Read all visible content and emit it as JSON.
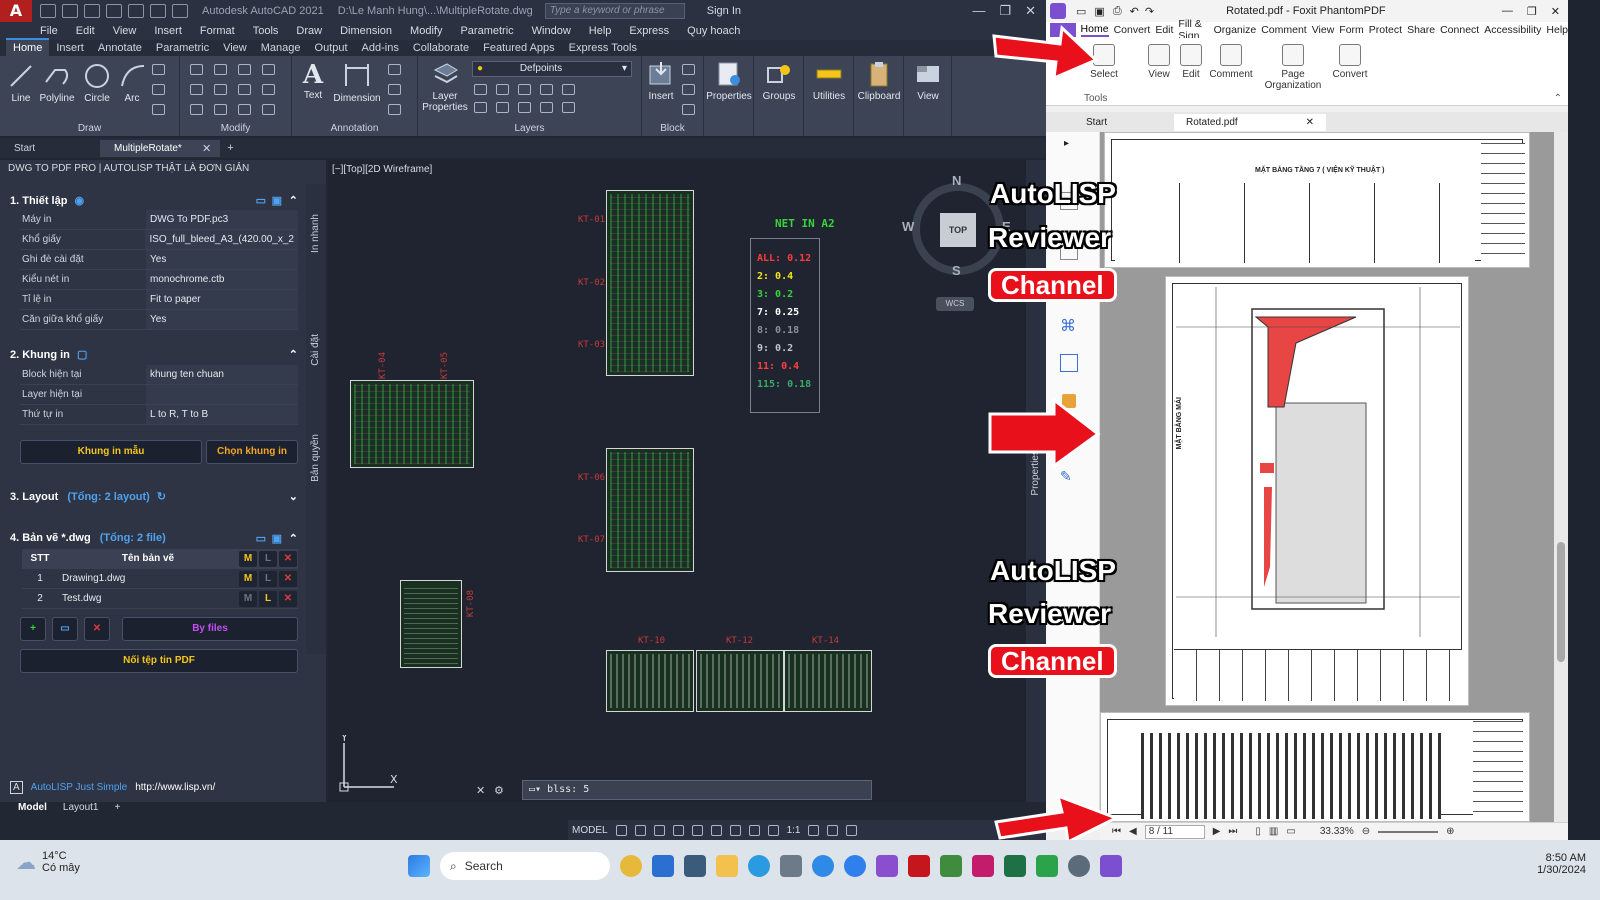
{
  "acad": {
    "title": "Autodesk AutoCAD 2021",
    "path": "D:\\Le Manh Hung\\...\\MultipleRotate.dwg",
    "search_placeholder": "Type a keyword or phrase",
    "signin": "Sign In",
    "menu": [
      "File",
      "Edit",
      "View",
      "Insert",
      "Format",
      "Tools",
      "Draw",
      "Dimension",
      "Modify",
      "Parametric",
      "Window",
      "Help",
      "Express",
      "Quy hoach"
    ],
    "ribbon_tabs": [
      "Home",
      "Insert",
      "Annotate",
      "Parametric",
      "View",
      "Manage",
      "Output",
      "Add-ins",
      "Collaborate",
      "Featured Apps",
      "Express Tools"
    ],
    "tools": {
      "line": "Line",
      "polyline": "Polyline",
      "circle": "Circle",
      "arc": "Arc",
      "text": "Text",
      "dimension": "Dimension",
      "layer_properties": "Layer\nProperties",
      "insert": "Insert",
      "properties": "Properties",
      "groups": "Groups",
      "utilities": "Utilities",
      "clipboard": "Clipboard",
      "view": "View"
    },
    "panels": {
      "draw": "Draw",
      "modify": "Modify",
      "annotation": "Annotation",
      "layers": "Layers",
      "block": "Block"
    },
    "layer_current": "Defpoints",
    "doc_tabs": [
      "Start",
      "MultipleRotate*"
    ],
    "palette": {
      "header": "DWG TO PDF PRO | AUTOLISP THẬT LÀ ĐƠN GIẢN",
      "sec1": "1.  Thiết lập",
      "sec1_rows": [
        {
          "k": "Máy in",
          "v": "DWG To PDF.pc3"
        },
        {
          "k": "Khổ giấy",
          "v": "ISO_full_bleed_A3_(420.00_x_2"
        },
        {
          "k": "Ghi đè cài đặt",
          "v": "Yes"
        },
        {
          "k": "Kiểu nét in",
          "v": "monochrome.ctb"
        },
        {
          "k": "Tỉ lệ in",
          "v": "Fit to paper"
        },
        {
          "k": "Căn giữa khổ giấy",
          "v": "Yes"
        }
      ],
      "sec2": "2.  Khung in",
      "sec2_rows": [
        {
          "k": "Block hiện tại",
          "v": "khung ten chuan"
        },
        {
          "k": "Layer hiện tại",
          "v": ""
        },
        {
          "k": "Thứ tự in",
          "v": "L to R, T to B"
        }
      ],
      "btn_sample": "Khung in mẫu",
      "btn_pick": "Chọn khung in",
      "sec3": "3.  Layout",
      "sec3_count": "(Tổng: 2 layout)",
      "sec4": "4.  Bản vẽ *.dwg",
      "sec4_count": "(Tổng: 2 file)",
      "tbl_stt": "STT",
      "tbl_name": "Tên bản vẽ",
      "files": [
        {
          "stt": "1",
          "name": "Drawing1.dwg"
        },
        {
          "stt": "2",
          "name": "Test.dwg"
        }
      ],
      "btn_byfiles": "By files",
      "btn_merge": "Nối tệp tin PDF",
      "foot_brand": "AutoLISP Just Simple",
      "foot_url": "http://www.lisp.vn/",
      "side_labels": [
        "In nhanh",
        "Cài đặt",
        "Bản quyền"
      ]
    },
    "view_label": "[−][Top][2D Wireframe]",
    "net_title": "NET IN A2",
    "net_items": [
      {
        "t": "ALL: 0.12",
        "c": "#ff3b3b"
      },
      {
        "t": "2: 0.4",
        "c": "#f5e614"
      },
      {
        "t": "3: 0.2",
        "c": "#39d439"
      },
      {
        "t": "7: 0.25",
        "c": "#ffffff"
      },
      {
        "t": "8: 0.18",
        "c": "#8a8f99"
      },
      {
        "t": "9: 0.2",
        "c": "#c0c4cc"
      },
      {
        "t": "11: 0.4",
        "c": "#ff4040"
      },
      {
        "t": "115: 0.18",
        "c": "#3aa86a"
      }
    ],
    "sheet_labels": {
      "kt01": "KT-01",
      "kt02": "KT-02",
      "kt03": "KT-03",
      "kt06": "KT-06",
      "kt07": "KT-07",
      "kt10": "KT-10",
      "kt12": "KT-12",
      "kt14": "KT-14",
      "kt04": "KT-04",
      "kt05": "KT-05",
      "kt08": "KT-08"
    },
    "viewcube": {
      "n": "N",
      "s": "S",
      "e": "E",
      "w": "W",
      "top": "TOP",
      "wcs": "WCS"
    },
    "cmd": "blss: 5",
    "layout_tabs": [
      "Model",
      "Layout1"
    ],
    "status_model": "MODEL",
    "status_scale": "1:1",
    "properties_strip": "Properties"
  },
  "foxit": {
    "title": "Rotated.pdf - Foxit PhantomPDF",
    "menu": [
      "Home",
      "Convert",
      "Edit",
      "Fill & Sign",
      "Organize",
      "Comment",
      "View",
      "Form",
      "Protect",
      "Share",
      "Connect",
      "Accessibility",
      "Help"
    ],
    "tools": {
      "select": "Select",
      "view": "View",
      "edit": "Edit",
      "comment": "Comment",
      "page_org": "Page\nOrganization",
      "convert": "Convert",
      "group": "Tools"
    },
    "tabs": [
      "Start",
      "Rotated.pdf"
    ],
    "page1_title": "MẶT BẰNG TẦNG 7 ( VIỆN KỸ THUẬT )",
    "page2_side": "MẶT BẰNG MÁI",
    "page_num": "8 / 11",
    "zoom": "33.33%"
  },
  "overlay": {
    "cap1a": "AutoLISP",
    "cap1b": "Reviewer",
    "chan1": "Channel",
    "cap2a": "AutoLISP",
    "cap2b": "Reviewer",
    "chan2": "Channel"
  },
  "taskbar": {
    "temp": "14°C",
    "weather": "Có mây",
    "search": "Search",
    "time": "8:50 AM",
    "date": "1/30/2024"
  }
}
